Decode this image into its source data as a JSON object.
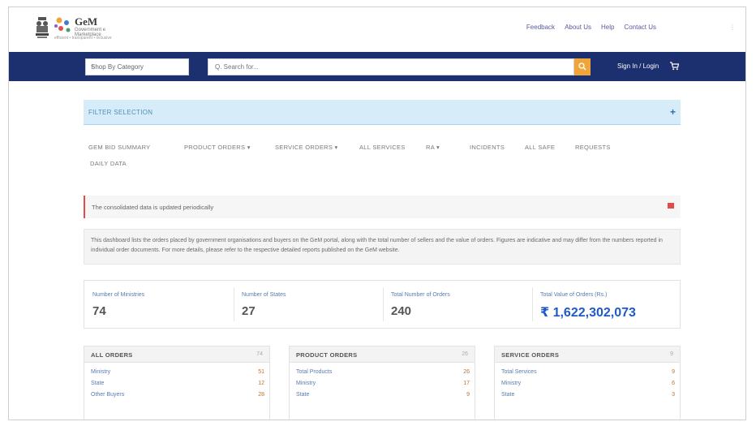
{
  "header": {
    "logo_text": "GeM",
    "logo_sub": "Government e Marketplace",
    "logo_tag": "efficient • transparent • inclusive",
    "links": [
      "Feedback",
      "About Us",
      "Help",
      "Contact Us"
    ],
    "corner": "⋮"
  },
  "navbar": {
    "category_label": "Shop By Category",
    "search_placeholder": "Q. Search for...",
    "login_label": "Sign In / Login",
    "colors": {
      "bg": "#1c2f6e",
      "search_btn": "#f0a53a"
    }
  },
  "filter": {
    "title": "FILTER SELECTION",
    "toggle": "+"
  },
  "tabs": [
    "GEM BID SUMMARY",
    "PRODUCT ORDERS ▾",
    "SERVICE ORDERS ▾",
    "ALL SERVICES",
    "RA ▾",
    "INCIDENTS",
    "ALL SAFE",
    "REQUESTS",
    "DAILY DATA"
  ],
  "alert": {
    "text": "The consolidated data is updated periodically"
  },
  "info": {
    "text": "This dashboard lists the orders placed by government organisations and buyers on the GeM portal, along with the total number of sellers and the value of orders. Figures are indicative and may differ from the numbers reported in individual order documents. For more details, please refer to the respective detailed reports published on the GeM website."
  },
  "stats": [
    {
      "label": "Number of Ministries",
      "value": "74"
    },
    {
      "label": "Number of States",
      "value": "27"
    },
    {
      "label": "Total Number of Orders",
      "value": "240"
    },
    {
      "label": "Total Value of Orders (Rs.)",
      "value": "₹ 1,622,302,073"
    }
  ],
  "cards": [
    {
      "title": "ALL ORDERS",
      "count": "74",
      "rows": [
        {
          "name": "Ministry",
          "value": "51"
        },
        {
          "name": "State",
          "value": "12"
        },
        {
          "name": "Other Buyers",
          "value": "28"
        }
      ]
    },
    {
      "title": "PRODUCT ORDERS",
      "count": "26",
      "rows": [
        {
          "name": "Total Products",
          "value": "26"
        },
        {
          "name": "Ministry",
          "value": "17"
        },
        {
          "name": "State",
          "value": "9"
        }
      ]
    },
    {
      "title": "SERVICE ORDERS",
      "count": "9",
      "rows": [
        {
          "name": "Total Services",
          "value": "9"
        },
        {
          "name": "Ministry",
          "value": "6"
        },
        {
          "name": "State",
          "value": "3"
        }
      ]
    }
  ]
}
